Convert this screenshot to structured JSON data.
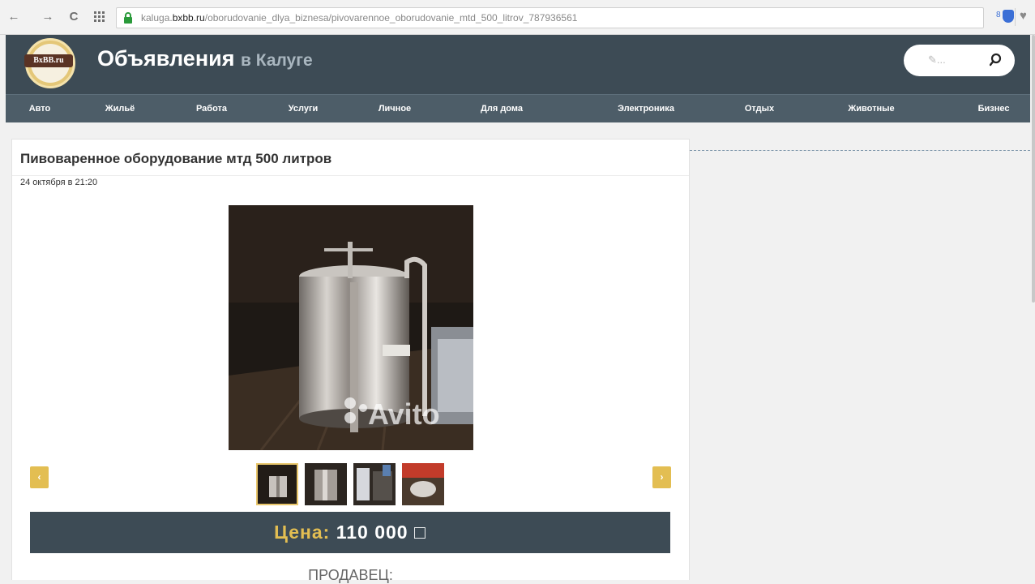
{
  "browser": {
    "url_prefix": "kaluga.",
    "url_domain": "bxbb.ru",
    "url_path": "/oborudovanie_dlya_biznesa/pivovarennoe_oborudovanie_mtd_500_litrov_787936561",
    "ext_count": "8",
    "back_icon": "←",
    "forward_icon": "→",
    "reload_icon": "C",
    "heart_icon": "♥"
  },
  "site": {
    "logo_text": "BxBB.ru",
    "title": "Объявления",
    "city": "в Калуге",
    "search_placeholder": "✎..."
  },
  "menu": [
    {
      "label": "Авто"
    },
    {
      "label": "Жильё"
    },
    {
      "label": "Работа"
    },
    {
      "label": "Услуги"
    },
    {
      "label": "Личное"
    },
    {
      "label": "Для дома"
    },
    {
      "label": "Электроника"
    },
    {
      "label": "Отдых"
    },
    {
      "label": "Животные"
    },
    {
      "label": "Бизнес"
    }
  ],
  "ad": {
    "title": "Пивоваренное оборудование мтд 500 литров",
    "date": "24 октября в 21:20",
    "watermark": "Avito",
    "price_label": "Цена:",
    "price_value": "110 000 □",
    "seller_label": "ПРОДАВЕЦ:",
    "prev_arrow": "‹",
    "next_arrow": "›"
  },
  "colors": {
    "header_bg": "#3d4b55",
    "menu_bg": "#4d5d68",
    "accent": "#e3be52"
  }
}
